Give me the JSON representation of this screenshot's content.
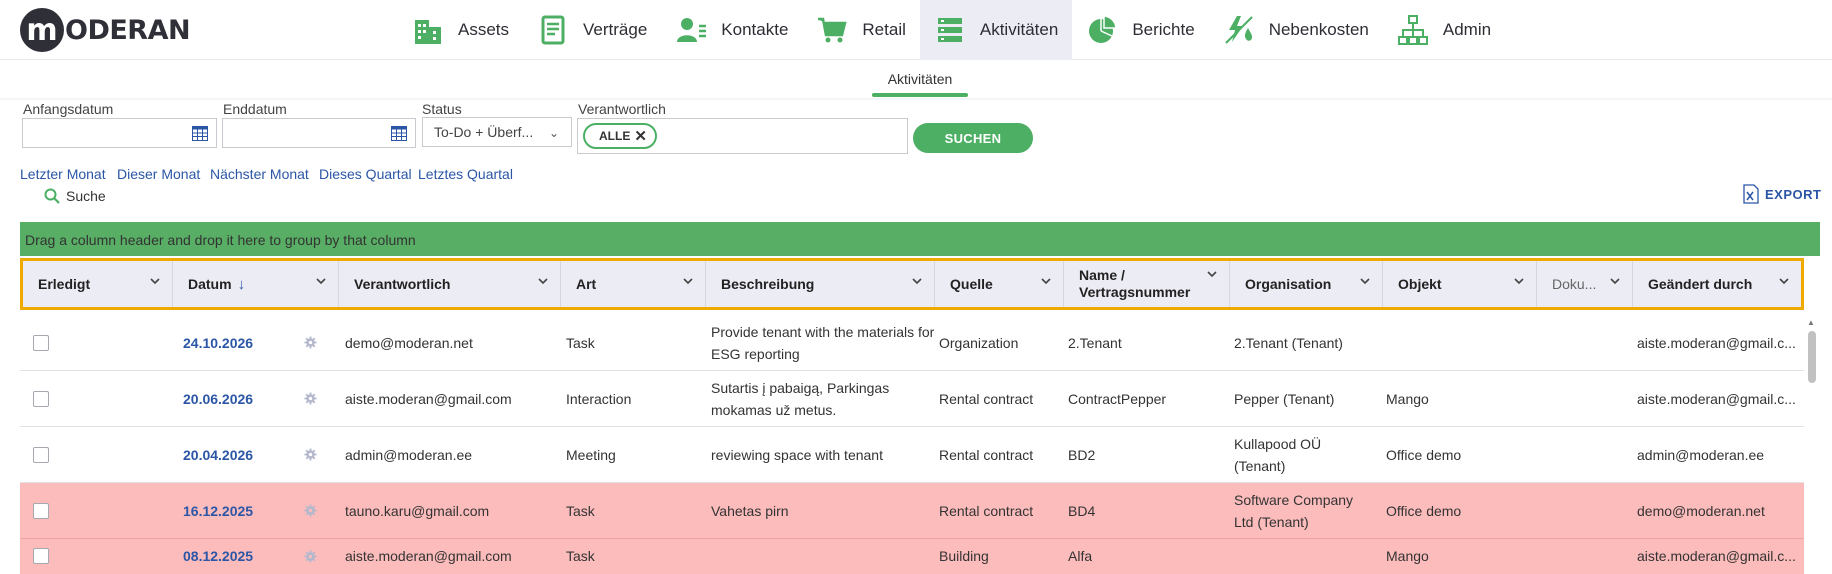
{
  "app": {
    "logo_letter": "m",
    "logo_text": "ODERAN"
  },
  "nav": [
    {
      "label": "Assets",
      "icon": "buildings-icon"
    },
    {
      "label": "Verträge",
      "icon": "contract-document-icon"
    },
    {
      "label": "Kontakte",
      "icon": "contacts-icon"
    },
    {
      "label": "Retail",
      "icon": "shopping-cart-icon"
    },
    {
      "label": "Aktivitäten",
      "icon": "activities-list-icon",
      "active": true
    },
    {
      "label": "Berichte",
      "icon": "pie-chart-icon"
    },
    {
      "label": "Nebenkosten",
      "icon": "utilities-icon"
    },
    {
      "label": "Admin",
      "icon": "org-chart-icon"
    }
  ],
  "subtab": {
    "label": "Aktivitäten"
  },
  "filters": {
    "start_label": "Anfangsdatum",
    "end_label": "Enddatum",
    "status_label": "Status",
    "status_value": "To-Do + Überf...",
    "responsible_label": "Verantwortlich",
    "responsible_chip": "ALLE",
    "search_button": "SUCHEN"
  },
  "quick_filters": [
    "Letzter Monat",
    "Dieser Monat",
    "Nächster Monat",
    "Dieses Quartal",
    "Letztes Quartal"
  ],
  "search_link": "Suche",
  "export_label": "EXPORT",
  "grid": {
    "group_hint": "Drag a column header and drop it here to group by that column",
    "columns": [
      "Erledigt",
      "Datum",
      "Verantwortlich",
      "Art",
      "Beschreibung",
      "Quelle",
      "Name /",
      "Vertragsnummer",
      "Organisation",
      "Objekt",
      "Doku...",
      "Geändert durch"
    ],
    "rows": [
      {
        "date": "24.10.2026",
        "responsible": "demo@moderan.net",
        "type": "Task",
        "description": "Provide tenant with the materials for ESG reporting",
        "source": "Organization",
        "name": "2.Tenant",
        "organisation": "2.Tenant (Tenant)",
        "object": "",
        "changed_by": "aiste.moderan@gmail.c...",
        "overdue": false
      },
      {
        "date": "20.06.2026",
        "responsible": "aiste.moderan@gmail.com",
        "type": "Interaction",
        "description": "Sutartis į pabaigą, Parkingas mokamas už metus.",
        "source": "Rental contract",
        "name": "ContractPepper",
        "organisation": "Pepper (Tenant)",
        "object": "Mango",
        "changed_by": "aiste.moderan@gmail.c...",
        "overdue": false
      },
      {
        "date": "20.04.2026",
        "responsible": "admin@moderan.ee",
        "type": "Meeting",
        "description": "reviewing space with tenant",
        "source": "Rental contract",
        "name": "BD2",
        "organisation": "Kullapood OÜ (Tenant)",
        "object": "Office demo",
        "changed_by": "admin@moderan.ee",
        "overdue": false
      },
      {
        "date": "16.12.2025",
        "responsible": "tauno.karu@gmail.com",
        "type": "Task",
        "description": "Vahetas pirn",
        "source": "Rental contract",
        "name": "BD4",
        "organisation": "Software Company Ltd (Tenant)",
        "object": "Office demo",
        "changed_by": "demo@moderan.net",
        "overdue": true
      },
      {
        "date": "08.12.2025",
        "responsible": "aiste.moderan@gmail.com",
        "type": "Task",
        "description": "",
        "source": "Building",
        "name": "Alfa",
        "organisation": "",
        "object": "Mango",
        "changed_by": "aiste.moderan@gmail.c...",
        "overdue": true
      }
    ]
  },
  "colors": {
    "accent_green": "#4caf64",
    "link_blue": "#2b56a6",
    "overdue_row": "#fdbcbc",
    "header_outline": "#f0a900"
  }
}
